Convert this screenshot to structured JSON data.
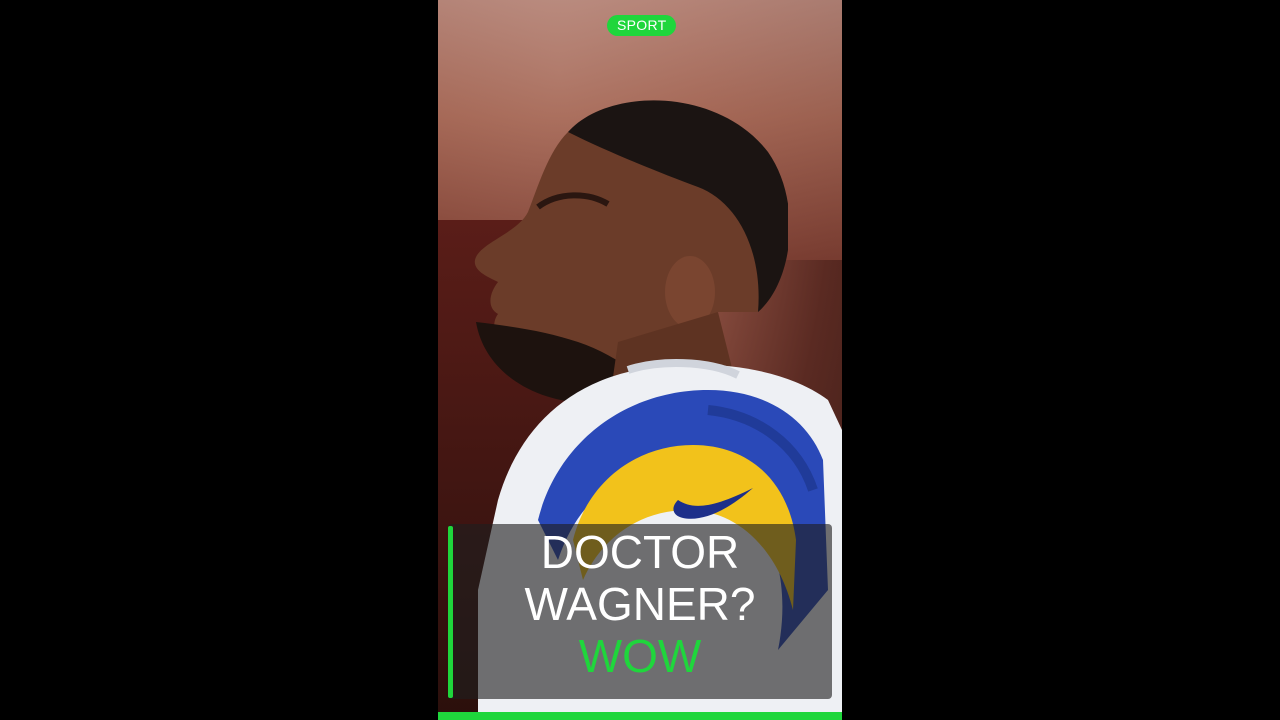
{
  "video": {
    "category_badge": "SPORT",
    "caption": {
      "line1": "DOCTOR",
      "line2": "WAGNER?",
      "line3": "WOW"
    },
    "progress_percent": 100
  },
  "colors": {
    "accent": "#1fd63c",
    "caption_bg": "#1e1e1e",
    "text": "#ffffff",
    "letterbox": "#000000"
  },
  "icons": {
    "jersey_logo": "swoosh-logo"
  }
}
